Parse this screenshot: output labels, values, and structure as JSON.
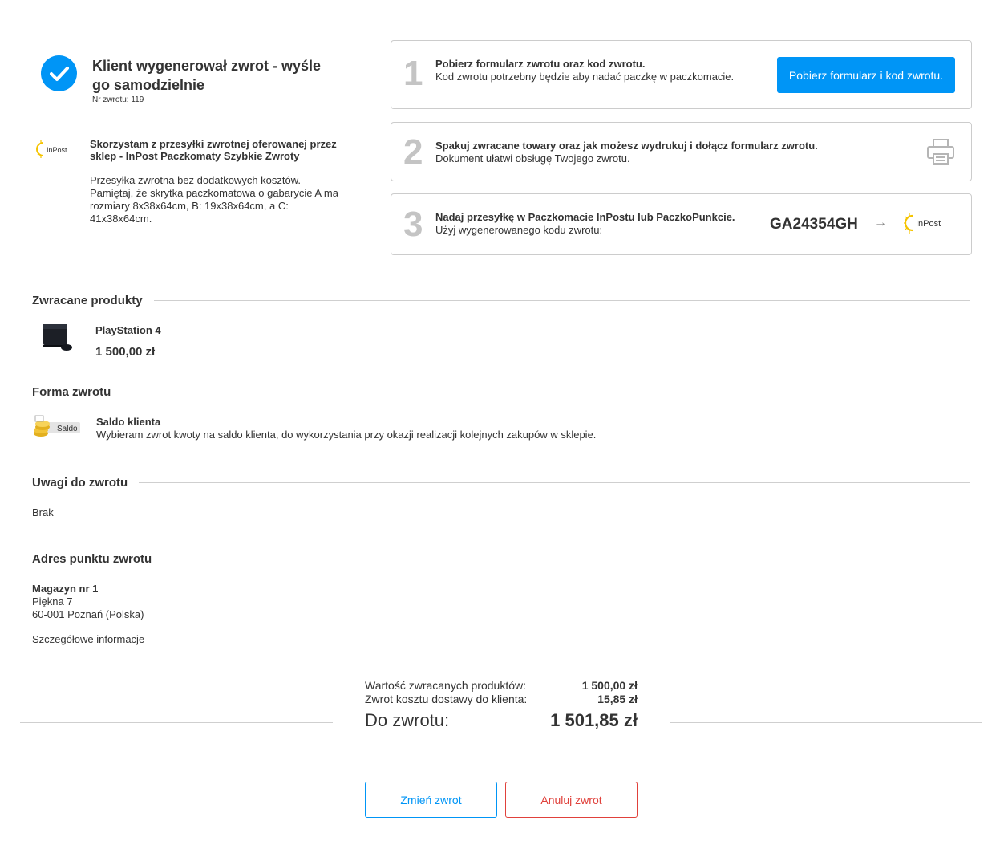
{
  "status": {
    "title": "Klient wygenerował zwrot - wyśle go samodzielnie",
    "return_number": "Nr zwrotu: 119",
    "icon": "checkmark-icon",
    "color": "#0095f6"
  },
  "carrier": {
    "logo_text": "InPost",
    "name": "Skorzystam z przesyłki zwrotnej oferowanej przez sklep - InPost Paczkomaty Szybkie Zwroty",
    "description": "Przesyłka zwrotna bez dodatkowych kosztów. Pamiętaj, że skrytka paczkomatowa o gabarycie A ma rozmiary 8x38x64cm, B: 19x38x64cm, a C: 41x38x64cm."
  },
  "steps": [
    {
      "number": "1",
      "title": "Pobierz formularz zwrotu oraz kod zwrotu.",
      "description": "Kod zwrotu potrzebny będzie aby nadać paczkę w paczkomacie.",
      "button_label": "Pobierz formularz i kod zwrotu."
    },
    {
      "number": "2",
      "title": "Spakuj zwracane towary oraz jak możesz wydrukuj i dołącz formularz zwrotu.",
      "description": "Dokument ułatwi obsługę Twojego zwrotu.",
      "icon": "printer-icon"
    },
    {
      "number": "3",
      "title": "Nadaj przesyłkę w Paczkomacie InPostu lub PaczkoPunkcie.",
      "description": "Użyj wygenerowanego kodu zwrotu:",
      "code": "GA24354GH",
      "arrow": "→",
      "logo_text": "InPost"
    }
  ],
  "products": {
    "heading": "Zwracane produkty",
    "items": [
      {
        "name": "PlayStation 4",
        "price": "1 500,00 zł"
      }
    ]
  },
  "return_form": {
    "heading": "Forma zwrotu",
    "logo_text": "Saldo",
    "title": "Saldo klienta",
    "description": "Wybieram zwrot kwoty na saldo klienta, do wykorzystania przy okazji realizacji kolejnych zakupów w sklepie."
  },
  "notes": {
    "heading": "Uwagi do zwrotu",
    "text": "Brak"
  },
  "address": {
    "heading": "Adres punktu zwrotu",
    "name": "Magazyn nr 1",
    "street": "Piękna 7",
    "city": "60-001 Poznań (Polska)",
    "details_link": "Szczegółowe informacje"
  },
  "summary": {
    "products_label": "Wartość zwracanych produktów:",
    "products_value": "1 500,00 zł",
    "shipping_label": "Zwrot kosztu dostawy do klienta:",
    "shipping_value": "15,85 zł",
    "total_label": "Do zwrotu:",
    "total_value": "1 501,85 zł"
  },
  "actions": {
    "change_label": "Zmień zwrot",
    "cancel_label": "Anuluj zwrot"
  },
  "colors": {
    "accent": "#0095f6",
    "danger": "#e0413b"
  }
}
